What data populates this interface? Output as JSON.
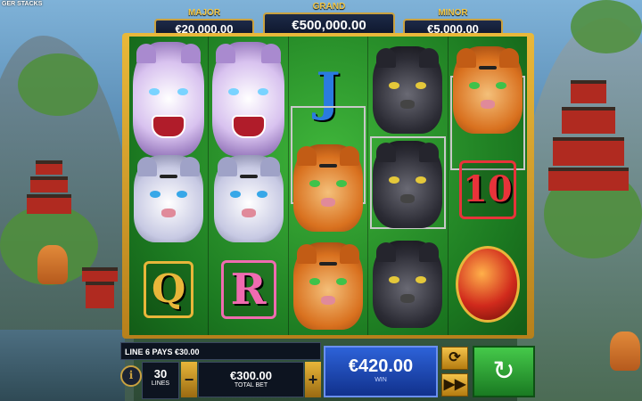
{
  "brand": "GER STACKS",
  "jackpots": {
    "major": {
      "label": "MAJOR",
      "value": "€20,000.00"
    },
    "grand": {
      "label": "GRAND",
      "value": "€500,000.00"
    },
    "minor": {
      "label": "MINOR",
      "value": "€5,000.00"
    }
  },
  "reels": [
    [
      "purple-tiger",
      "white-tiger",
      "Q"
    ],
    [
      "purple-tiger",
      "white-tiger",
      "R"
    ],
    [
      "J",
      "orange-tiger",
      "orange-tiger"
    ],
    [
      "black-panther",
      "black-panther",
      "black-panther"
    ],
    [
      "orange-tiger",
      "10",
      "lantern-pot"
    ]
  ],
  "symbols": {
    "j": "J",
    "q": "Q",
    "r": "R",
    "ten": "10"
  },
  "panel": {
    "message": "LINE 6 PAYS €30.00",
    "lines_value": "30",
    "lines_label": "LINES",
    "total_bet_value": "€300.00",
    "total_bet_label": "TOTAL BET",
    "win_value": "€420.00",
    "win_label": "WIN",
    "minus": "−",
    "plus": "+",
    "info": "i"
  },
  "icons": {
    "autoplay": "autoplay-icon",
    "turbo": "fast-forward-icon",
    "spin": "spin-arrow-icon"
  },
  "colors": {
    "gold": "#c9a140",
    "win_blue": "#2d62d8",
    "spin_green": "#45c94a",
    "reel_green": "#1c7a21"
  }
}
